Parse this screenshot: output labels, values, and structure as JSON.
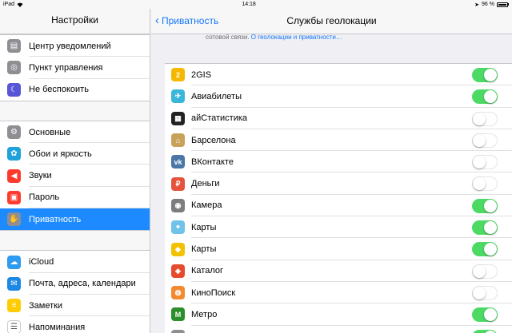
{
  "status_bar": {
    "device": "iPad",
    "time": "14:18",
    "battery": "96 %"
  },
  "sidebar": {
    "title": "Настройки",
    "groups": [
      [
        {
          "label": "Центр уведомлений",
          "icon": "notification-center-icon",
          "color": "#8e8e93",
          "glyph": "▤"
        },
        {
          "label": "Пункт управления",
          "icon": "control-center-icon",
          "color": "#8e8e93",
          "glyph": "◎"
        },
        {
          "label": "Не беспокоить",
          "icon": "moon-icon",
          "color": "#5856d6",
          "glyph": "☾"
        }
      ],
      [
        {
          "label": "Основные",
          "icon": "gear-icon",
          "color": "#8e8e93",
          "glyph": "⚙"
        },
        {
          "label": "Обои и яркость",
          "icon": "wallpaper-icon",
          "color": "#1fa2d9",
          "glyph": "✿"
        },
        {
          "label": "Звуки",
          "icon": "speaker-icon",
          "color": "#ff3b30",
          "glyph": "◀"
        },
        {
          "label": "Пароль",
          "icon": "lock-icon",
          "color": "#ff3b30",
          "glyph": "▣"
        },
        {
          "label": "Приватность",
          "icon": "hand-icon",
          "color": "#8e8e93",
          "glyph": "✋",
          "active": true
        }
      ],
      [
        {
          "label": "iCloud",
          "icon": "icloud-icon",
          "color": "#2c9bf0",
          "glyph": "☁"
        },
        {
          "label": "Почта, адреса, календари",
          "icon": "mail-icon",
          "color": "#1e88e5",
          "glyph": "✉"
        },
        {
          "label": "Заметки",
          "icon": "notes-icon",
          "color": "#ffcc00",
          "glyph": "≡"
        },
        {
          "label": "Напоминания",
          "icon": "reminders-icon",
          "color": "#ffffff",
          "glyph": "☰"
        }
      ]
    ]
  },
  "navbar": {
    "back_label": "Приватность",
    "title": "Службы геолокации"
  },
  "hint": {
    "text": "сотовой связи.",
    "link": "О геолокации и приватности…"
  },
  "apps": [
    {
      "label": "2GIS",
      "icon": "2gis-icon",
      "color": "#f5b800",
      "glyph": "2",
      "on": true
    },
    {
      "label": "Авиабилеты",
      "icon": "aviabilety-icon",
      "color": "#3ab7d8",
      "glyph": "✈",
      "on": true
    },
    {
      "label": "айСтатистика",
      "icon": "istatistika-icon",
      "color": "#222222",
      "glyph": "▦",
      "on": false
    },
    {
      "label": "Барселона",
      "icon": "barcelona-icon",
      "color": "#c9a25a",
      "glyph": "⌂",
      "on": false
    },
    {
      "label": "ВКонтакте",
      "icon": "vk-icon",
      "color": "#4a76a8",
      "glyph": "vk",
      "on": false
    },
    {
      "label": "Деньги",
      "icon": "money-icon",
      "color": "#e5533d",
      "glyph": "₽",
      "on": false
    },
    {
      "label": "Камера",
      "icon": "camera-icon",
      "color": "#7d7d80",
      "glyph": "◉",
      "on": true
    },
    {
      "label": "Карты",
      "icon": "maps-icon",
      "color": "#6fc2e8",
      "glyph": "⌖",
      "on": true
    },
    {
      "label": "Карты",
      "icon": "maps-alt-icon",
      "color": "#f2c200",
      "glyph": "◆",
      "on": true
    },
    {
      "label": "Каталог",
      "icon": "catalog-icon",
      "color": "#e54b2c",
      "glyph": "◈",
      "on": false
    },
    {
      "label": "КиноПоиск",
      "icon": "kinopoisk-icon",
      "color": "#f28b30",
      "glyph": "◍",
      "on": false
    },
    {
      "label": "Метро",
      "icon": "metro-icon",
      "color": "#2b8f2b",
      "glyph": "M",
      "on": true
    },
    {
      "label": "",
      "icon": "partial-row-icon",
      "color": "#8e8e93",
      "glyph": "",
      "on": true
    }
  ]
}
